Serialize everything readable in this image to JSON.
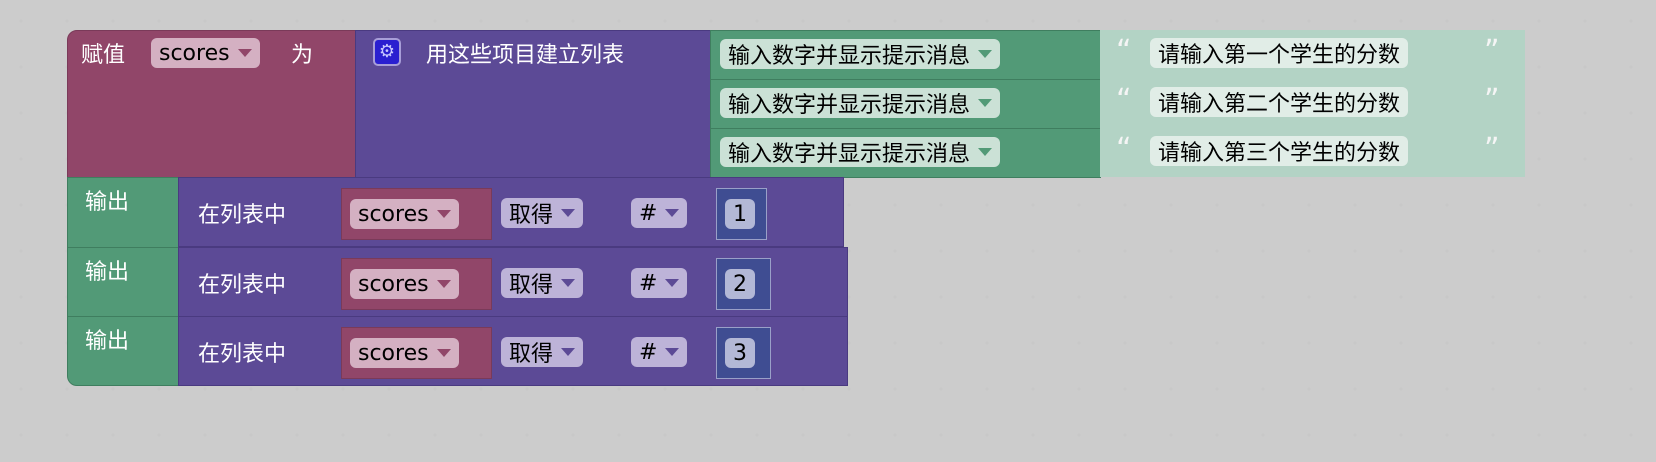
{
  "set_block": {
    "label_set": "赋值",
    "variable": "scores",
    "label_to": "为"
  },
  "list_block": {
    "icon": "gear-icon",
    "label": "用这些项目建立列表"
  },
  "items": [
    {
      "dropdown": "输入数字并显示提示消息",
      "open_quote": "“",
      "text": "请输入第一个学生的分数",
      "close_quote": "”"
    },
    {
      "dropdown": "输入数字并显示提示消息",
      "open_quote": "“",
      "text": "请输入第二个学生的分数",
      "close_quote": "”"
    },
    {
      "dropdown": "输入数字并显示提示消息",
      "open_quote": "“",
      "text": "请输入第三个学生的分数",
      "close_quote": "”"
    }
  ],
  "outputs": [
    {
      "label": "输出",
      "in_list": "在列表中",
      "variable": "scores",
      "op": "取得",
      "where": "#",
      "index": "1"
    },
    {
      "label": "输出",
      "in_list": "在列表中",
      "variable": "scores",
      "op": "取得",
      "where": "#",
      "index": "2"
    },
    {
      "label": "输出",
      "in_list": "在列表中",
      "variable": "scores",
      "op": "取得",
      "where": "#",
      "index": "3"
    }
  ],
  "colors": {
    "variables": "#914669",
    "lists": "#5c4a96",
    "io": "#529a77",
    "text": "#b3d3c5",
    "math": "#3f4d92"
  }
}
